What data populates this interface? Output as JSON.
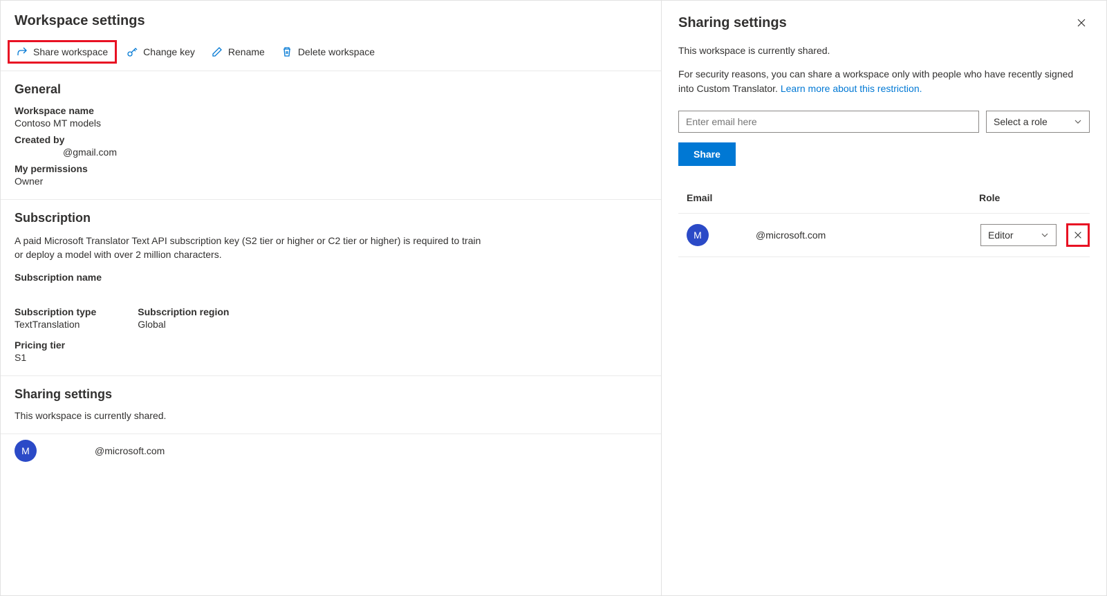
{
  "left": {
    "title": "Workspace settings",
    "toolbar": {
      "share": "Share workspace",
      "changeKey": "Change key",
      "rename": "Rename",
      "delete": "Delete workspace"
    },
    "general": {
      "heading": "General",
      "workspaceNameLabel": "Workspace name",
      "workspaceName": "Contoso MT models",
      "createdByLabel": "Created by",
      "createdBy": "@gmail.com",
      "permissionsLabel": "My permissions",
      "permissions": "Owner"
    },
    "subscription": {
      "heading": "Subscription",
      "description": "A paid Microsoft Translator Text API subscription key (S2 tier or higher or C2 tier or higher) is required to train or deploy a model with over 2 million characters.",
      "nameLabel": "Subscription name",
      "name": "",
      "typeLabel": "Subscription type",
      "type": "TextTranslation",
      "regionLabel": "Subscription region",
      "region": "Global",
      "tierLabel": "Pricing tier",
      "tier": "S1"
    },
    "sharing": {
      "heading": "Sharing settings",
      "status": "This workspace is currently shared.",
      "member": {
        "initial": "M",
        "email": "@microsoft.com"
      }
    }
  },
  "right": {
    "title": "Sharing settings",
    "status": "This workspace is currently shared.",
    "securityText": "For security reasons, you can share a workspace only with people who have recently signed into Custom Translator. ",
    "learnMore": "Learn more about this restriction.",
    "emailPlaceholder": "Enter email here",
    "rolePlaceholder": "Select a role",
    "shareButton": "Share",
    "table": {
      "emailHeader": "Email",
      "roleHeader": "Role",
      "row": {
        "initial": "M",
        "email": "@microsoft.com",
        "role": "Editor"
      }
    }
  }
}
